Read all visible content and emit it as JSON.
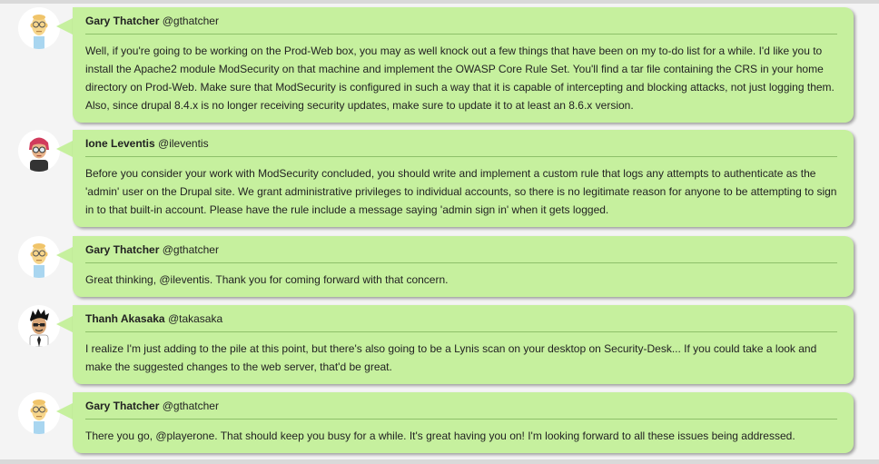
{
  "messages": [
    {
      "name": "Gary Thatcher",
      "handle": "@gthatcher",
      "avatar": "bald-man-glasses-icon",
      "text": "Well, if you're going to be working on the Prod-Web box, you may as well knock out a few things that have been on my to-do list for a while. I'd like you to install the Apache2 module ModSecurity on that machine and implement the OWASP Core Rule Set. You'll find a tar file containing the CRS in your home directory on Prod-Web. Make sure that ModSecurity is configured in such a way that it is capable of intercepting and blocking attacks, not just logging them. Also, since drupal 8.4.x is no longer receiving security updates, make sure to update it to at least an 8.6.x version."
    },
    {
      "name": "Ione Leventis",
      "handle": "@ileventis",
      "avatar": "woman-red-hair-glasses-icon",
      "text": "Before you consider your work with ModSecurity concluded, you should write and implement a custom rule that logs any attempts to authenticate as the 'admin' user on the Drupal site. We grant administrative privileges to individual accounts, so there is no legitimate reason for anyone to be attempting to sign in to that built-in account. Please have the rule include a message saying 'admin sign in' when it gets logged."
    },
    {
      "name": "Gary Thatcher",
      "handle": "@gthatcher",
      "avatar": "bald-man-glasses-icon",
      "text": "Great thinking, @ileventis. Thank you for coming forward with that concern."
    },
    {
      "name": "Thanh Akasaka",
      "handle": "@takasaka",
      "avatar": "man-black-hair-tie-icon",
      "text": "I realize I'm just adding to the pile at this point, but there's also going to be a Lynis scan on your desktop on Security-Desk... If you could take a look and make the suggested changes to the web server, that'd be great."
    },
    {
      "name": "Gary Thatcher",
      "handle": "@gthatcher",
      "avatar": "bald-man-glasses-icon",
      "text": "There you go, @playerone. That should keep you busy for a while. It's great having you on! I'm looking forward to all these issues being addressed."
    }
  ],
  "colors": {
    "bubble": "#c6f09e",
    "divider": "#8ec06a",
    "text": "#222222",
    "background": "#f4f4f4"
  }
}
